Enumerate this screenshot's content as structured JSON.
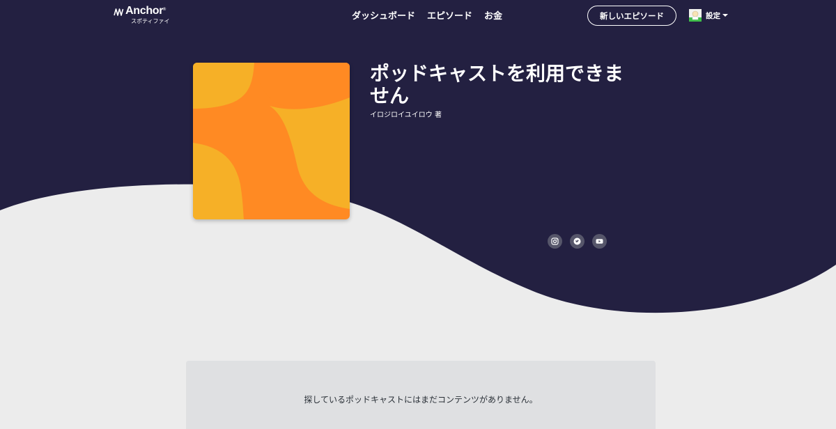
{
  "colors": {
    "navy": "#232041",
    "light_bg": "#ececec",
    "card_bg": "#dfe0e2",
    "cover_orange": "#ff8a23",
    "cover_yellow": "#f6b027",
    "icon_bg": "#56566a"
  },
  "nav": {
    "logo": {
      "name": "Anchor",
      "subtitle": "スポティファイ"
    },
    "links": [
      "ダッシュボード",
      "エピソード",
      "お金"
    ],
    "new_episode_label": "新しいエピソード",
    "user_label": "設定"
  },
  "podcast": {
    "title": "ポッドキャストを利用できません",
    "author": "イロジロイユイロウ 著",
    "social_icons": [
      "instagram-icon",
      "twitter-icon",
      "youtube-icon"
    ]
  },
  "empty_state": {
    "message": "探しているポッドキャストにはまだコンテンツがありません。"
  }
}
